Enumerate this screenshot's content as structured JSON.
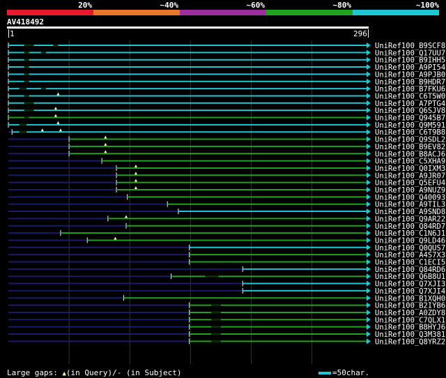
{
  "header": {
    "percent_labels": [
      "20%",
      "~40%",
      "~60%",
      "~80%",
      "~100%"
    ],
    "band_colors": [
      "#e8192c",
      "#e8772a",
      "#9b2f9e",
      "#1ea31e",
      "#1ec8d2"
    ]
  },
  "query": {
    "name": "AV418492",
    "start": "1",
    "end": "296"
  },
  "legend": {
    "gap_text": "Large gaps:",
    "query_symbol": "▲",
    "query_text": "(in Query)/",
    "subject_symbol": "-",
    "subject_text": " (in Subject)",
    "scale_text": "=50char."
  },
  "colors": {
    "high": "#1ec8d2",
    "mid": "#1ea31e",
    "low": "#1a1a6e",
    "grid": "#2a3a2a",
    "gap": "#1a4a1a"
  },
  "hits": [
    {
      "name": "UniRef100_B9SCF8",
      "start": 1,
      "end": 296,
      "color": "high",
      "gaps": [
        [
          14,
          22
        ],
        [
          38,
          42
        ]
      ],
      "marks": []
    },
    {
      "name": "UniRef100_Q17UU7",
      "start": 1,
      "end": 296,
      "color": "high",
      "gaps": [
        [
          14,
          18
        ],
        [
          28,
          32
        ]
      ],
      "marks": []
    },
    {
      "name": "UniRef100_B9IHH5",
      "start": 1,
      "end": 296,
      "color": "high",
      "gaps": [
        [
          14,
          18
        ]
      ],
      "marks": []
    },
    {
      "name": "UniRef100_A9PI54",
      "start": 1,
      "end": 296,
      "color": "high",
      "gaps": [
        [
          14,
          18
        ]
      ],
      "marks": []
    },
    {
      "name": "UniRef100_A9PJB0",
      "start": 1,
      "end": 296,
      "color": "high",
      "gaps": [
        [
          14,
          18
        ]
      ],
      "marks": []
    },
    {
      "name": "UniRef100_B9HDR7",
      "start": 1,
      "end": 296,
      "color": "high",
      "gaps": [
        [
          14,
          18
        ]
      ],
      "marks": []
    },
    {
      "name": "UniRef100_B7FKU6",
      "start": 1,
      "end": 296,
      "color": "high",
      "gaps": [
        [
          10,
          16
        ],
        [
          28,
          32
        ]
      ],
      "marks": []
    },
    {
      "name": "UniRef100_C6T5W0",
      "start": 1,
      "end": 296,
      "color": "high",
      "gaps": [
        [
          14,
          18
        ]
      ],
      "marks": [
        42
      ]
    },
    {
      "name": "UniRef100_A7PTG4",
      "start": 1,
      "end": 296,
      "color": "high",
      "gaps": [
        [
          14,
          22
        ]
      ],
      "marks": []
    },
    {
      "name": "UniRef100_Q6SJV8",
      "start": 1,
      "end": 296,
      "color": "high",
      "gaps": [
        [
          14,
          22
        ]
      ],
      "marks": [
        40
      ]
    },
    {
      "name": "UniRef100_Q945B7",
      "start": 1,
      "end": 296,
      "color": "mid",
      "gaps": [
        [
          14,
          18
        ]
      ],
      "marks": [
        40
      ]
    },
    {
      "name": "UniRef100_Q9M591",
      "start": 1,
      "end": 296,
      "color": "high",
      "gaps": [
        [
          10,
          16
        ]
      ],
      "marks": [
        42
      ]
    },
    {
      "name": "UniRef100_C6T9B8",
      "start": 4,
      "end": 296,
      "color": "high",
      "gaps": [
        [
          10,
          16
        ]
      ],
      "marks": [
        29,
        44
      ]
    },
    {
      "name": "UniRef100_Q9SDL2",
      "start": 51,
      "end": 296,
      "color": "mid",
      "gaps": [],
      "marks": [
        81
      ]
    },
    {
      "name": "UniRef100_B9EV82",
      "start": 51,
      "end": 296,
      "color": "mid",
      "gaps": [],
      "marks": [
        81
      ]
    },
    {
      "name": "UniRef100_B8ACJ6",
      "start": 51,
      "end": 296,
      "color": "mid",
      "gaps": [],
      "marks": [
        81
      ]
    },
    {
      "name": "UniRef100_C5XHA9",
      "start": 78,
      "end": 296,
      "color": "mid",
      "gaps": [],
      "marks": []
    },
    {
      "name": "UniRef100_Q0IXM3",
      "start": 90,
      "end": 296,
      "color": "mid",
      "gaps": [],
      "marks": [
        106
      ]
    },
    {
      "name": "UniRef100_A9JR07",
      "start": 90,
      "end": 296,
      "color": "mid",
      "gaps": [],
      "marks": [
        106
      ]
    },
    {
      "name": "UniRef100_Q5EFU4",
      "start": 90,
      "end": 296,
      "color": "mid",
      "gaps": [],
      "marks": [
        106
      ]
    },
    {
      "name": "UniRef100_A9NUZ9",
      "start": 90,
      "end": 296,
      "color": "mid",
      "gaps": [],
      "marks": [
        106
      ]
    },
    {
      "name": "UniRef100_Q40093",
      "start": 99,
      "end": 296,
      "color": "mid",
      "gaps": [],
      "marks": []
    },
    {
      "name": "UniRef100_A9TIL3",
      "start": 132,
      "end": 296,
      "color": "mid",
      "gaps": [],
      "marks": []
    },
    {
      "name": "UniRef100_A9SND8",
      "start": 141,
      "end": 296,
      "color": "high",
      "gaps": [],
      "marks": []
    },
    {
      "name": "UniRef100_Q9AR22",
      "start": 83,
      "end": 296,
      "color": "mid",
      "gaps": [],
      "marks": [
        98
      ]
    },
    {
      "name": "UniRef100_Q84RD7",
      "start": 98,
      "end": 296,
      "color": "mid",
      "gaps": [],
      "marks": []
    },
    {
      "name": "UniRef100_C1N6J1",
      "start": 44,
      "end": 296,
      "color": "mid",
      "gaps": [],
      "marks": []
    },
    {
      "name": "UniRef100_Q9LD46",
      "start": 66,
      "end": 296,
      "color": "mid",
      "gaps": [],
      "marks": [
        89
      ]
    },
    {
      "name": "UniRef100_Q0QUS7",
      "start": 150,
      "end": 296,
      "color": "high",
      "gaps": [],
      "marks": []
    },
    {
      "name": "UniRef100_A4S7X3",
      "start": 150,
      "end": 296,
      "color": "mid",
      "gaps": [],
      "marks": []
    },
    {
      "name": "UniRef100_C1ECI5",
      "start": 150,
      "end": 296,
      "color": "mid",
      "gaps": [],
      "marks": []
    },
    {
      "name": "UniRef100_Q84RD6",
      "start": 194,
      "end": 296,
      "color": "high",
      "gaps": [],
      "marks": []
    },
    {
      "name": "UniRef100_Q6B8U1",
      "start": 135,
      "end": 296,
      "color": "mid",
      "gaps": [
        [
          163,
          174
        ]
      ],
      "marks": []
    },
    {
      "name": "UniRef100_Q7XJI3",
      "start": 194,
      "end": 296,
      "color": "high",
      "gaps": [],
      "marks": []
    },
    {
      "name": "UniRef100_Q7XJI4",
      "start": 194,
      "end": 296,
      "color": "high",
      "gaps": [],
      "marks": []
    },
    {
      "name": "UniRef100_B1XQH0",
      "start": 96,
      "end": 296,
      "color": "mid",
      "gaps": [],
      "marks": []
    },
    {
      "name": "UniRef100_B2IYB6",
      "start": 150,
      "end": 296,
      "color": "mid",
      "gaps": [
        [
          168,
          176
        ]
      ],
      "marks": []
    },
    {
      "name": "UniRef100_A0ZDY8",
      "start": 150,
      "end": 296,
      "color": "mid",
      "gaps": [
        [
          168,
          176
        ]
      ],
      "marks": []
    },
    {
      "name": "UniRef100_C7QLX1",
      "start": 150,
      "end": 296,
      "color": "mid",
      "gaps": [
        [
          168,
          176
        ]
      ],
      "marks": []
    },
    {
      "name": "UniRef100_B8HYJ6",
      "start": 150,
      "end": 296,
      "color": "mid",
      "gaps": [
        [
          168,
          176
        ]
      ],
      "marks": []
    },
    {
      "name": "UniRef100_Q3M381",
      "start": 150,
      "end": 296,
      "color": "mid",
      "gaps": [
        [
          168,
          176
        ]
      ],
      "marks": []
    },
    {
      "name": "UniRef100_Q8YRZ2",
      "start": 150,
      "end": 296,
      "color": "mid",
      "gaps": [
        [
          168,
          176
        ]
      ],
      "marks": []
    }
  ]
}
